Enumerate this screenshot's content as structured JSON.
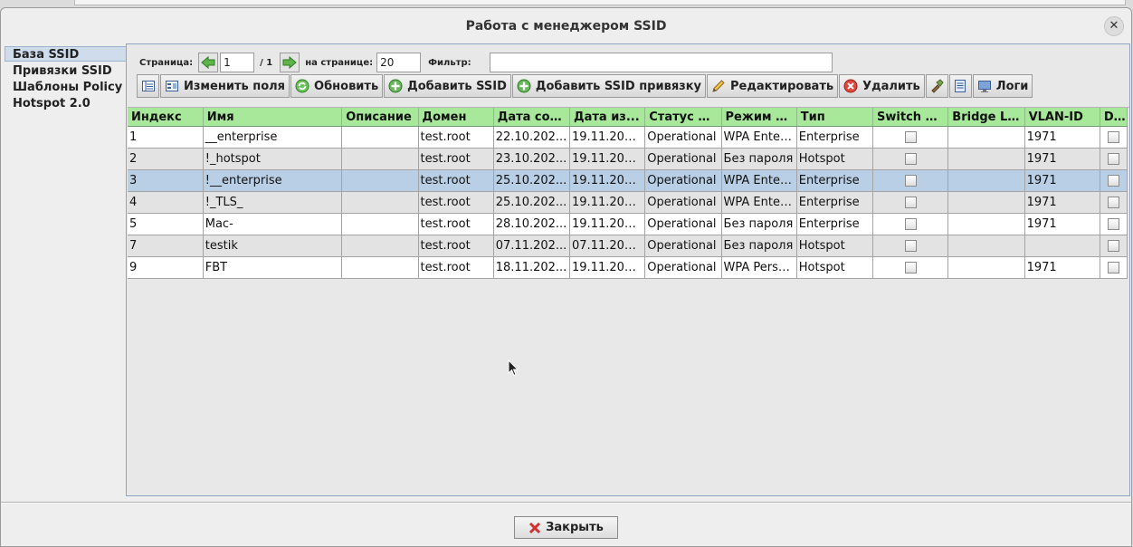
{
  "window": {
    "title": "Работа с менеджером SSID",
    "close_glyph": "✕"
  },
  "tabs": [
    {
      "label": "База SSID",
      "active": true
    },
    {
      "label": "Привязки SSID",
      "active": false
    },
    {
      "label": "Шаблоны Policy",
      "active": false
    },
    {
      "label": "Hotspot 2.0",
      "active": false
    }
  ],
  "pager": {
    "page_label": "Страница:",
    "page_value": "1",
    "page_total": "/ 1",
    "per_page_label": "на странице:",
    "per_page_value": "20",
    "filter_label": "Фильтр:",
    "filter_value": ""
  },
  "toolbar": {
    "columns_label": "Изменить поля",
    "refresh_label": "Обновить",
    "add_ssid_label": "Добавить SSID",
    "add_binding_label": "Добавить SSID привязку",
    "edit_label": "Редактировать",
    "delete_label": "Удалить",
    "logs_label": "Логи"
  },
  "table": {
    "columns": [
      "Индекс",
      "Имя",
      "Описание",
      "Домен",
      "Дата соз...",
      "Дата из...",
      "Статус S...",
      "Режим б...",
      "Тип",
      "Switch C...",
      "Bridge L...",
      "VLAN-ID",
      "D..."
    ],
    "rows": [
      {
        "index": "1",
        "name": "__enterprise",
        "desc": "",
        "domain": "test.root",
        "created": "22.10.202...",
        "modified": "19.11.202...",
        "status": "Operational",
        "mode": "WPA Enter...",
        "type": "Enterprise",
        "bridge": "",
        "vlan": "1971",
        "selected": false
      },
      {
        "index": "2",
        "name": "!_hotspot",
        "desc": "",
        "domain": "test.root",
        "created": "23.10.202...",
        "modified": "19.11.202...",
        "status": "Operational",
        "mode": "Без пароля",
        "type": "Hotspot",
        "bridge": "",
        "vlan": "1971",
        "selected": false
      },
      {
        "index": "3",
        "name": "!__enterprise",
        "desc": "",
        "domain": "test.root",
        "created": "25.10.202...",
        "modified": "19.11.202...",
        "status": "Operational",
        "mode": "WPA Enter...",
        "type": "Enterprise",
        "bridge": "",
        "vlan": "1971",
        "selected": true
      },
      {
        "index": "4",
        "name": "!_TLS_",
        "desc": "",
        "domain": "test.root",
        "created": "25.10.202...",
        "modified": "19.11.202...",
        "status": "Operational",
        "mode": "WPA Enter...",
        "type": "Enterprise",
        "bridge": "",
        "vlan": "1971",
        "selected": false
      },
      {
        "index": "5",
        "name": "Mac-",
        "desc": "",
        "domain": "test.root",
        "created": "28.10.202...",
        "modified": "19.11.202...",
        "status": "Operational",
        "mode": "Без пароля",
        "type": "Enterprise",
        "bridge": "",
        "vlan": "1971",
        "selected": false
      },
      {
        "index": "7",
        "name": "testik",
        "desc": "",
        "domain": "test.root",
        "created": "07.11.202...",
        "modified": "07.11.202...",
        "status": "Operational",
        "mode": "Без пароля",
        "type": "Hotspot",
        "bridge": "",
        "vlan": "",
        "selected": false
      },
      {
        "index": "9",
        "name": "FBT",
        "desc": "",
        "domain": "test.root",
        "created": "18.11.202...",
        "modified": "19.11.202...",
        "status": "Operational",
        "mode": "WPA Perso...",
        "type": "Hotspot",
        "bridge": "",
        "vlan": "1971",
        "selected": false
      }
    ]
  },
  "footer": {
    "close_label": "Закрыть"
  },
  "colors": {
    "header_green": "#a8e89a",
    "selection_blue": "#b8cfe5",
    "active_tab": "#cfdcec"
  }
}
